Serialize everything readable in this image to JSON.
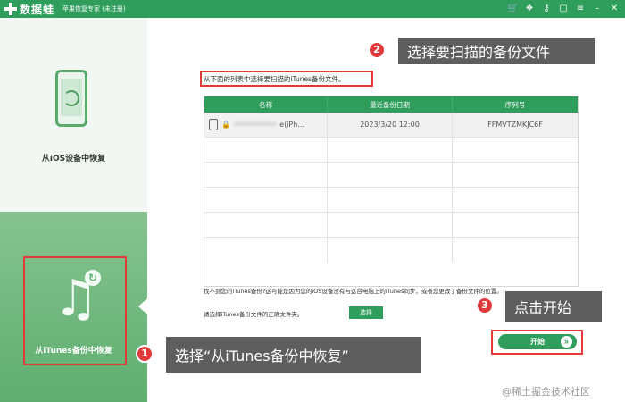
{
  "titlebar": {
    "app_name": "数据蛙",
    "subtitle": "苹果恢复专家 (未注册)",
    "icons": [
      "cart-icon",
      "gift-icon",
      "key-icon",
      "chat-icon",
      "menu-icon",
      "minimize-icon",
      "close-icon"
    ]
  },
  "sidebar": {
    "items": [
      {
        "label": "从iOS设备中恢复",
        "icon": "phone-sync-icon",
        "active": false
      },
      {
        "label": "从iTunes备份中恢复",
        "icon": "music-note-refresh-icon",
        "active": true
      }
    ]
  },
  "main": {
    "instruction": "从下面的列表中选择要扫描的iTunes备份文件。",
    "table": {
      "headers": [
        "名称",
        "最近备份日期",
        "序列号"
      ],
      "rows": [
        {
          "name": "e(iPh...",
          "date": "2023/3/20 12:00",
          "serial": "FFMVTZMKJC6F"
        }
      ]
    },
    "hint": "找不到您的iTunes备份?这可能是因为您的iOS设备没有与这台电脑上的iTunes同步，或者您更改了备份文件的位置。",
    "choose_text": "请选择iTunes备份文件的正确文件夹。",
    "choose_button": "选择",
    "start_button": "开始"
  },
  "callouts": [
    {
      "number": "1",
      "text": "选择“从iTunes备份中恢复”"
    },
    {
      "number": "2",
      "text": "选择要扫描的备份文件"
    },
    {
      "number": "3",
      "text": "点击开始"
    }
  ],
  "watermark": "@稀土掘金技术社区",
  "colors": {
    "brand_green": "#2f9e5c",
    "highlight_red": "#e23a3a",
    "callout_bg": "#505050"
  }
}
